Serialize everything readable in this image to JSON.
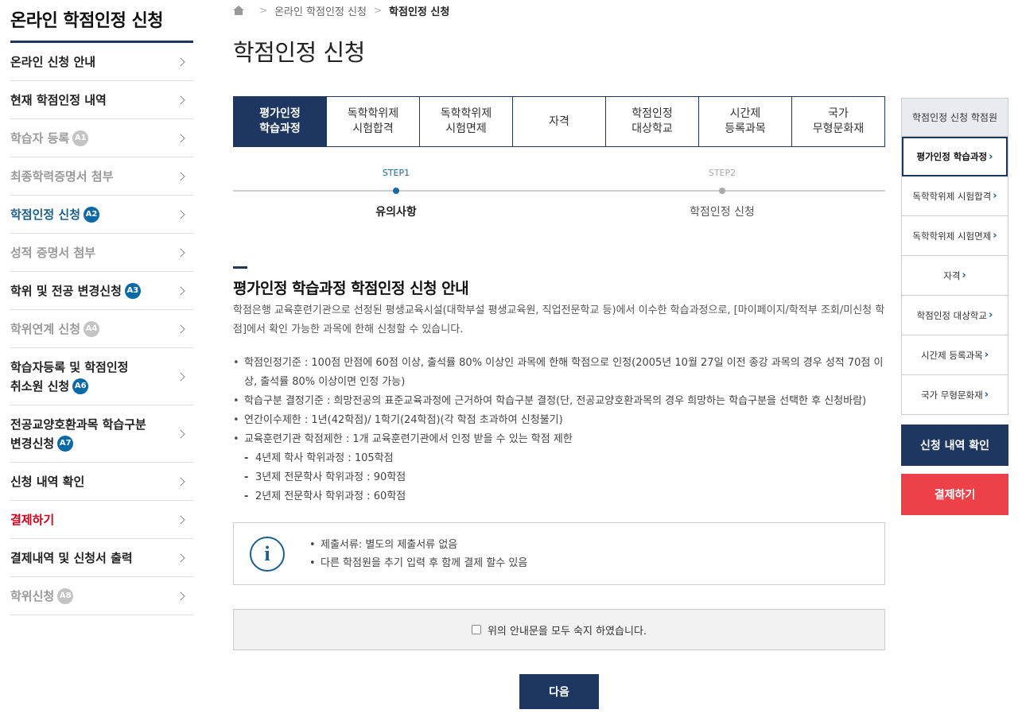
{
  "sidebar": {
    "title": "온라인 학점인정 신청",
    "items": [
      {
        "label": "온라인 신청 안내",
        "badge": ""
      },
      {
        "label": "현재 학점인정 내역",
        "badge": ""
      },
      {
        "label": "학습자 등록",
        "badge": "A1"
      },
      {
        "label": "최종학력증명서 첨부",
        "badge": ""
      },
      {
        "label": "학점인정 신청",
        "badge": "A2"
      },
      {
        "label": "성적 증명서 첨부",
        "badge": ""
      },
      {
        "label": "학위 및 전공 변경신청",
        "badge": "A3"
      },
      {
        "label": "학위연계 신청",
        "badge": "A4"
      },
      {
        "label_line1": "학습자등록 및 학점인정",
        "label_line2": "취소원 신청",
        "badge": "A6"
      },
      {
        "label_line1": "전공교양호환과목 학습구분",
        "label_line2": "변경신청",
        "badge": "A7"
      },
      {
        "label": "신청 내역 확인",
        "badge": ""
      },
      {
        "label": "결제하기",
        "badge": ""
      },
      {
        "label": "결제내역 및 신청서 출력",
        "badge": ""
      },
      {
        "label": "학위신청",
        "badge": "A8"
      }
    ]
  },
  "breadcrumb": {
    "items": [
      "온라인 학점인정 신청",
      "학점인정 신청"
    ]
  },
  "page": {
    "title": "학점인정 신청"
  },
  "tabs": [
    "평가인정\n학습과정",
    "독학학위제\n시험합격",
    "독학학위제\n시험면제",
    "자격",
    "학점인정\n대상학교",
    "시간제\n등록과목",
    "국가\n무형문화재"
  ],
  "steps": [
    {
      "num": "STEP1",
      "name": "유의사항"
    },
    {
      "num": "STEP2",
      "name": "학점인정 신청"
    }
  ],
  "section": {
    "title": "평가인정 학습과정 학점인정 신청 안내",
    "intro": "학점은행 교육훈련기관으로 선정된 평생교육시설(대학부설 평생교육원, 직업전문학교 등)에서 이수한 학습과정으로, [마이페이지/학적부 조회/미신청 학점]에서 확인 가능한 과목에 한해 신청할 수 있습니다.",
    "rules": [
      "학점인정기준 : 100점 만점에 60점 이상, 출석률 80% 이상인 과목에 한해 학점으로 인정(2005년 10월 27일 이전 종강 과목의 경우 성적 70점 이상, 출석률 80% 이상이면 인정 가능)",
      "학습구분 결정기준 : 희망전공의 표준교육과정에 근거하여 학습구분 결정(단, 전공교양호환과목의 경우 희망하는 학습구분을 선택한 후 신청바람)",
      "연간이수제한 : 1년(42학점)/ 1학기(24학점)(각 학점 초과하여 신청불기)",
      "교육훈련기관 학점제한 : 1개 교육훈련기관에서 인정 받을 수 있는 학점 제한"
    ],
    "subs": [
      "4년제 학사 학위과정 : 105학점",
      "3년제 전문학사 학위과정 : 90학점",
      "2년제 전문학사 학위과정 : 60학점"
    ]
  },
  "info": {
    "icon_letter": "i",
    "items": [
      "제출서류: 별도의 제출서류 없음",
      "다른 학점원을 추기 입력 후 함께 결제 할수 있음"
    ]
  },
  "agree": {
    "label": "위의 안내문을 모두 숙지 하였습니다."
  },
  "next_button": "다음",
  "right_panel": {
    "header": "학점인정 신청 학점원",
    "items": [
      "평가인정 학습과정",
      "독학학위제 시험합격",
      "독학학위제 시험면제",
      "자격",
      "학점인정 대상학교",
      "시간제 등록과목",
      "국가 무형문화재"
    ],
    "buttons": {
      "history": "신청 내역 확인",
      "pay": "결제하기"
    }
  },
  "colors": {
    "navy": "#1d3761",
    "accent_blue": "#1a5f8f",
    "red_button": "#ee4049",
    "red_text": "#d0021b"
  }
}
